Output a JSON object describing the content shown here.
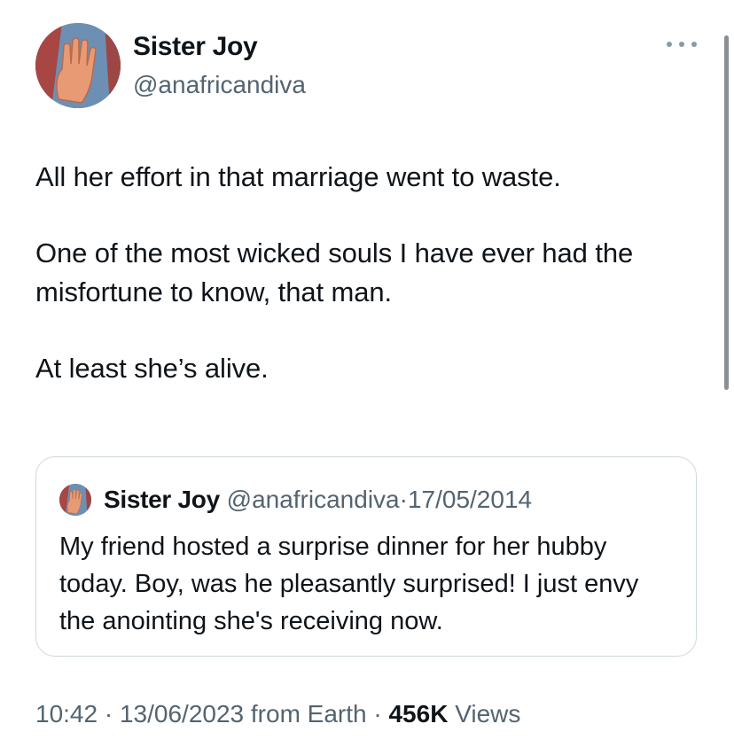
{
  "tweet": {
    "author": {
      "name": "Sister Joy",
      "handle": "@anafricandiva"
    },
    "paragraphs": [
      "All her effort in that marriage went to waste.",
      "One of the most wicked souls I have ever had the misfortune to know, that man.",
      "At least she’s alive."
    ],
    "more_icon": "more-horizontal-icon"
  },
  "quote": {
    "author": {
      "name": "Sister Joy",
      "handle": "@anafricandiva"
    },
    "separator": "·",
    "date": "17/05/2014",
    "text": "My friend hosted a surprise dinner for her hubby today. Boy, was he pleasantly surprised! I just envy the anointing she's receiving now."
  },
  "meta": {
    "time": "10:42",
    "separator": "·",
    "date": "13/06/2023",
    "source": "from Earth",
    "views_count": "456K",
    "views_label": "Views"
  },
  "colors": {
    "text": "#0f1419",
    "secondary": "#536471",
    "border": "#cfd9de"
  }
}
